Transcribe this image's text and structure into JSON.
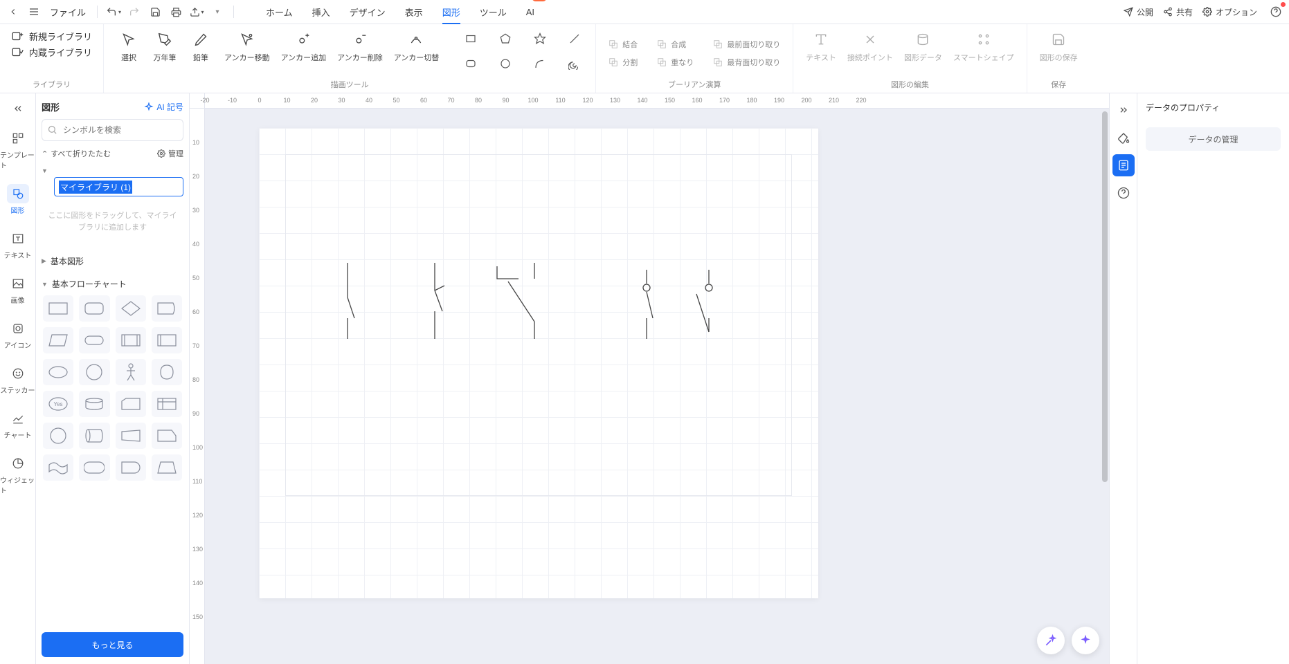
{
  "menubar": {
    "file_label": "ファイル",
    "tabs": [
      "ホーム",
      "挿入",
      "デザイン",
      "表示",
      "図形",
      "ツール",
      "AI"
    ],
    "active_tab": 4,
    "ai_badge": "hot",
    "right": {
      "publish": "公開",
      "share": "共有",
      "options": "オプション"
    }
  },
  "ribbon": {
    "groups": {
      "library": {
        "label": "ライブラリ",
        "new": "新規ライブラリ",
        "builtin": "内蔵ライブラリ"
      },
      "draw": {
        "label": "描画ツール",
        "tools": [
          "選択",
          "万年筆",
          "鉛筆",
          "アンカー移動",
          "アンカー追加",
          "アンカー削除",
          "アンカー切替"
        ]
      },
      "boolean": {
        "label": "ブーリアン演算",
        "tools": [
          "結合",
          "合成",
          "最前面切り取り",
          "分割",
          "重なり",
          "最背面切り取り"
        ]
      },
      "edit": {
        "label": "図形の編集",
        "tools": [
          "テキスト",
          "接続ポイント",
          "図形データ",
          "スマートシェイプ"
        ]
      },
      "save": {
        "label": "保存",
        "tool": "図形の保存"
      }
    }
  },
  "leftbar": {
    "items": [
      {
        "label": "テンプレート"
      },
      {
        "label": "図形",
        "active": true
      },
      {
        "label": "テキスト"
      },
      {
        "label": "画像"
      },
      {
        "label": "アイコン"
      },
      {
        "label": "ステッカー"
      },
      {
        "label": "チャート"
      },
      {
        "label": "ウィジェット"
      }
    ]
  },
  "shape_panel": {
    "title": "図形",
    "ai_symbol": "AI 記号",
    "search_placeholder": "シンボルを検索",
    "collapse_all": "すべて折りたたむ",
    "manage": "管理",
    "my_library_value": "マイライブラリ (1)",
    "drop_hint": "ここに図形をドラッグして、マイライブラリに追加します",
    "sections": {
      "basic": "基本図形",
      "flowchart": "基本フローチャート"
    },
    "more": "もっと見る"
  },
  "ruler": {
    "h_ticks": [
      -20,
      -10,
      0,
      10,
      20,
      30,
      40,
      50,
      60,
      70,
      80,
      90,
      100,
      110,
      120,
      130,
      140,
      150,
      160,
      170,
      180,
      190,
      200,
      210,
      220
    ],
    "v_ticks": [
      10,
      20,
      30,
      40,
      50,
      60,
      70,
      80,
      90,
      100,
      110,
      120,
      130,
      140,
      150
    ]
  },
  "rightpanel": {
    "title": "データのプロパティ",
    "manage": "データの管理"
  }
}
